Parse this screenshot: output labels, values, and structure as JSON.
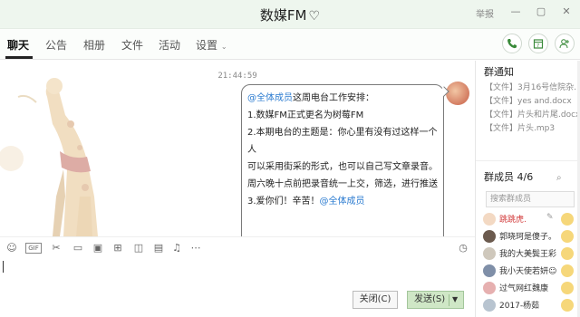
{
  "window": {
    "title": "数媒FM",
    "report_label": "举报"
  },
  "tabs": [
    {
      "label": "聊天"
    },
    {
      "label": "公告"
    },
    {
      "label": "相册"
    },
    {
      "label": "文件"
    },
    {
      "label": "活动"
    },
    {
      "label": "设置"
    }
  ],
  "chat": {
    "timestamp": "21:44:59",
    "message": {
      "mention": "@全体成员",
      "line1_rest": "这周电台工作安排：",
      "line2": "1.数媒FM正式更名为树莓FM",
      "line3": "2.本期电台的主题是：你心里有没有过这样一个人",
      "line4": "可以采用街采的形式，也可以自己写文章录音。",
      "line5": "周六晚十点前把录音统一上交，筛选，进行推送",
      "line6_text": "3.爱你们！辛苦！",
      "line6_mention": "@全体成员"
    }
  },
  "actions": {
    "close_label": "关闭(C)",
    "send_label": "发送(S)"
  },
  "right_panel": {
    "notice_title": "群通知",
    "notices": [
      "【文件】3月16号信院杂…",
      "【文件】yes and.docx",
      "【文件】片头和片尾.docx",
      "【文件】片头.mp3"
    ],
    "members_title": "群成员 4/6",
    "search_placeholder": "搜索群成员",
    "members": [
      {
        "name": "跳跳虎.",
        "color": "#d23b3b"
      },
      {
        "name": "郭晓珂是傻子。",
        "color": "#333333"
      },
      {
        "name": "我的大美鬓王彩…",
        "color": "#333333"
      },
      {
        "name": "我小天使若妍☺",
        "color": "#333333"
      },
      {
        "name": "过气网红魏康",
        "color": "#333333"
      },
      {
        "name": "2017-杨茹",
        "color": "#333333"
      }
    ]
  },
  "colors": {
    "titlebar_bg": "#eef6ee",
    "mention": "#2b7bd0",
    "send_bg": "#cfe7c6",
    "owner_name": "#d23b3b"
  },
  "icons": [
    "heart-icon",
    "minimize-icon",
    "maximize-icon",
    "close-icon",
    "phone-icon",
    "calendar-icon",
    "add-member-icon",
    "emoji-icon",
    "gif-icon",
    "scissors-icon",
    "folder-icon",
    "image-icon",
    "gift-icon",
    "shake-icon",
    "bell-icon",
    "more-icon",
    "history-icon",
    "search-icon",
    "edit-icon"
  ]
}
